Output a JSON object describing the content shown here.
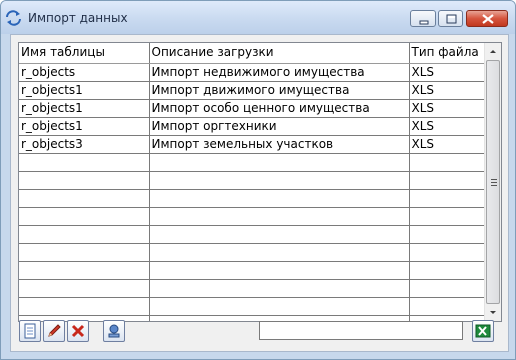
{
  "window": {
    "title": "Импорт данных",
    "icon": "refresh-arrows-icon"
  },
  "grid": {
    "columns": [
      "Имя таблицы",
      "Описание загрузки",
      "Тип файла"
    ],
    "rows": [
      [
        "r_objects",
        "Импорт недвижимого имущества",
        "XLS"
      ],
      [
        "r_objects1",
        "Импорт движимого имущества",
        "XLS"
      ],
      [
        "r_objects1",
        "Импорт особо ценного имущества",
        "XLS"
      ],
      [
        "r_objects1",
        "Импорт оргтехники",
        "XLS"
      ],
      [
        "r_objects3",
        "Импорт земельных участков",
        "XLS"
      ],
      [
        "",
        "",
        ""
      ],
      [
        "",
        "",
        ""
      ],
      [
        "",
        "",
        ""
      ],
      [
        "",
        "",
        ""
      ],
      [
        "",
        "",
        ""
      ],
      [
        "",
        "",
        ""
      ],
      [
        "",
        "",
        ""
      ],
      [
        "",
        "",
        ""
      ],
      [
        "",
        "",
        ""
      ],
      [
        "",
        "",
        ""
      ]
    ]
  },
  "toolbar": {
    "buttons": [
      "new-document-icon",
      "edit-pencil-icon",
      "delete-x-icon",
      "run-import-icon"
    ],
    "filter_value": "",
    "export_icon": "excel-export-icon"
  }
}
